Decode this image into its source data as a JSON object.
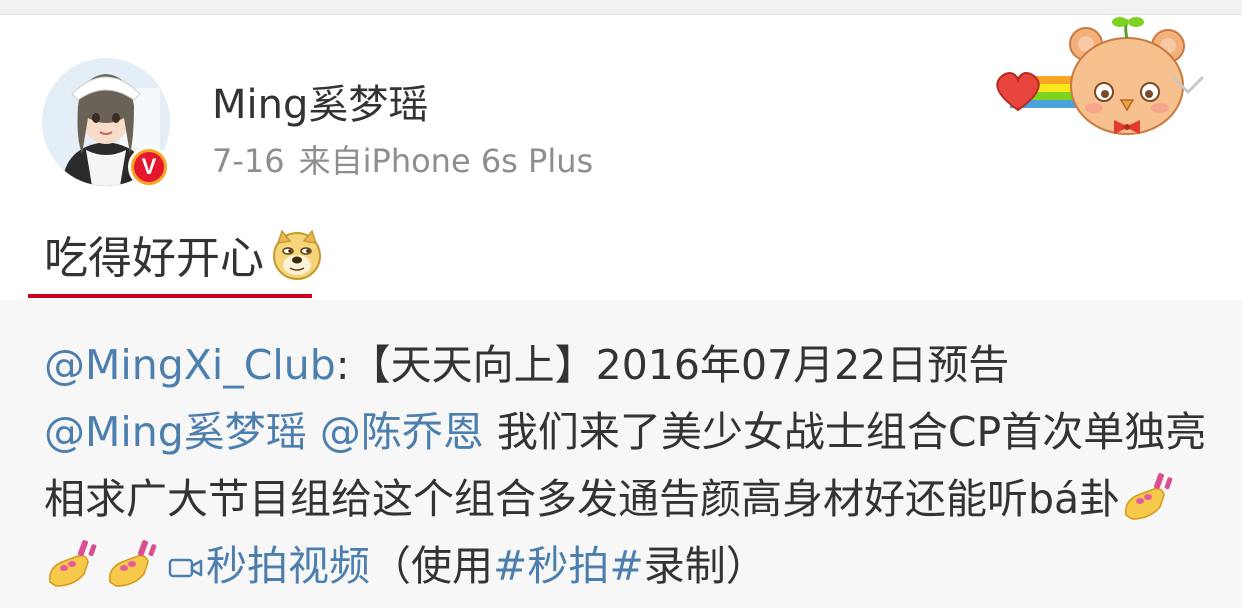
{
  "post": {
    "username": "Ming奚梦瑶",
    "date": "7-16",
    "source": "来自iPhone 6s Plus",
    "text": "吃得好开心",
    "verified_badge": "V"
  },
  "quoted": {
    "mention_author": "@MingXi_Club",
    "colon": ":",
    "title": "【天天向上】2016年07月22日预告",
    "mention_1": "@Ming奚梦瑶",
    "mention_2": "@陈乔恩",
    "body_1": " 我们来了美少女战士组合CP首次单独亮相求广大节目组给这个组合多发通告颜高身材好还能听bá卦",
    "video_label": "秒拍视频",
    "paren_open": "（使用",
    "hashtag": "#秒拍#",
    "paren_close": "录制）"
  },
  "icons": {
    "avatar": "avatar-girl",
    "badge": "verified-v-icon",
    "sticker": "bear-heart-sticker",
    "chevron": "chevron-down-icon",
    "emoji": "doge-emoji",
    "nails": "nail-polish-emoji",
    "video": "video-icon"
  },
  "colors": {
    "link": "#4d7fae",
    "accent_red": "#d0021b",
    "meta_gray": "#8e8e8e",
    "quoted_bg": "#f7f7f7"
  }
}
